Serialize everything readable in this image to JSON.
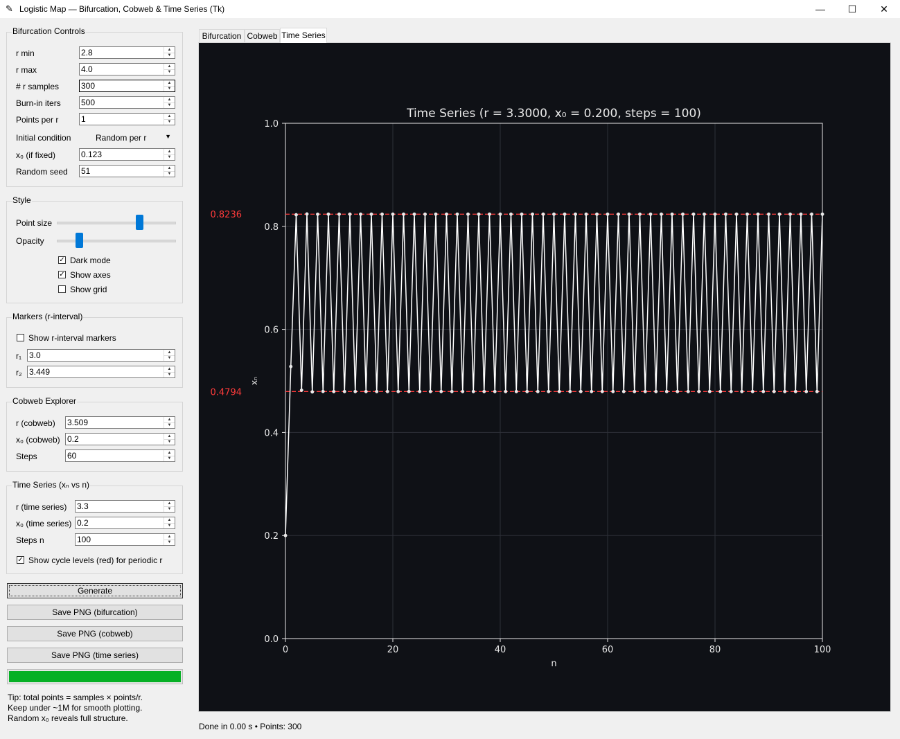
{
  "window": {
    "title": "Logistic Map — Bifurcation, Cobweb & Time Series (Tk)",
    "minimize": "—",
    "maximize": "☐",
    "close": "✕"
  },
  "bifurcation": {
    "title": "Bifurcation Controls",
    "rmin_label": "r min",
    "rmin": "2.8",
    "rmax_label": "r max",
    "rmax": "4.0",
    "samples_label": "# r samples",
    "samples": "300",
    "burnin_label": "Burn-in iters",
    "burnin": "500",
    "ppr_label": "Points per r",
    "ppr": "1",
    "ic_label": "Initial condition",
    "ic": "Random per r",
    "x0_label": "x₀ (if fixed)",
    "x0": "0.123",
    "seed_label": "Random seed",
    "seed": "51"
  },
  "style": {
    "title": "Style",
    "point_size_label": "Point size",
    "opacity_label": "Opacity",
    "point_size_level": 0.72,
    "opacity_level": 0.17,
    "dark_mode_label": "Dark mode",
    "dark_mode": true,
    "show_axes_label": "Show axes",
    "show_axes": true,
    "show_grid_label": "Show grid",
    "show_grid": false
  },
  "markers": {
    "title": "Markers (r-interval)",
    "show_label": "Show r-interval markers",
    "show": false,
    "r1_label": "r₁",
    "r1": "3.0",
    "r2_label": "r₂",
    "r2": "3.449"
  },
  "cobweb": {
    "title": "Cobweb Explorer",
    "r_label": "r (cobweb)",
    "r": "3.509",
    "x0_label": "x₀ (cobweb)",
    "x0": "0.2",
    "steps_label": "Steps",
    "steps": "60"
  },
  "timeseries": {
    "title": "Time Series (xₙ vs n)",
    "r_label": "r (time series)",
    "r": "3.3",
    "x0_label": "x₀ (time series)",
    "x0": "0.2",
    "steps_label": "Steps n",
    "steps": "100",
    "cycle_label": "Show cycle levels (red) for periodic r",
    "cycle": true
  },
  "buttons": {
    "generate": "Generate",
    "save_bif": "Save PNG (bifurcation)",
    "save_cob": "Save PNG (cobweb)",
    "save_ts": "Save PNG (time series)"
  },
  "progress": 1.0,
  "tip": {
    "line1": "Tip: total points = samples × points/r.",
    "line2": "Keep under ~1M for smooth plotting.",
    "line3": "Random x₀ reveals full structure."
  },
  "tabs": [
    "Bifurcation",
    "Cobweb",
    "Time Series"
  ],
  "active_tab": "Time Series",
  "status": "Done in 0.00 s • Points: 300",
  "colors": {
    "plot_bg": "#0f1116",
    "series": "#ffffff",
    "cycle_line": "#ff3b3b",
    "progress": "#06b025",
    "accent": "#0078d7"
  },
  "chart_data": {
    "type": "line",
    "title": "Time Series (r = 3.3000, x₀ = 0.200, steps = 100)",
    "xlabel": "n",
    "ylabel": "xₙ",
    "xlim": [
      0,
      100
    ],
    "ylim": [
      0.0,
      1.0
    ],
    "xticks": [
      "0",
      "20",
      "40",
      "60",
      "80",
      "100"
    ],
    "yticks": [
      "0.0",
      "0.2",
      "0.4",
      "0.6",
      "0.8",
      "1.0"
    ],
    "grid": true,
    "r": 3.3,
    "x0": 0.2,
    "steps": 100,
    "cycle_levels": [
      {
        "value": 0.8236,
        "label": "0.8236"
      },
      {
        "value": 0.4794,
        "label": "0.4794"
      }
    ]
  }
}
